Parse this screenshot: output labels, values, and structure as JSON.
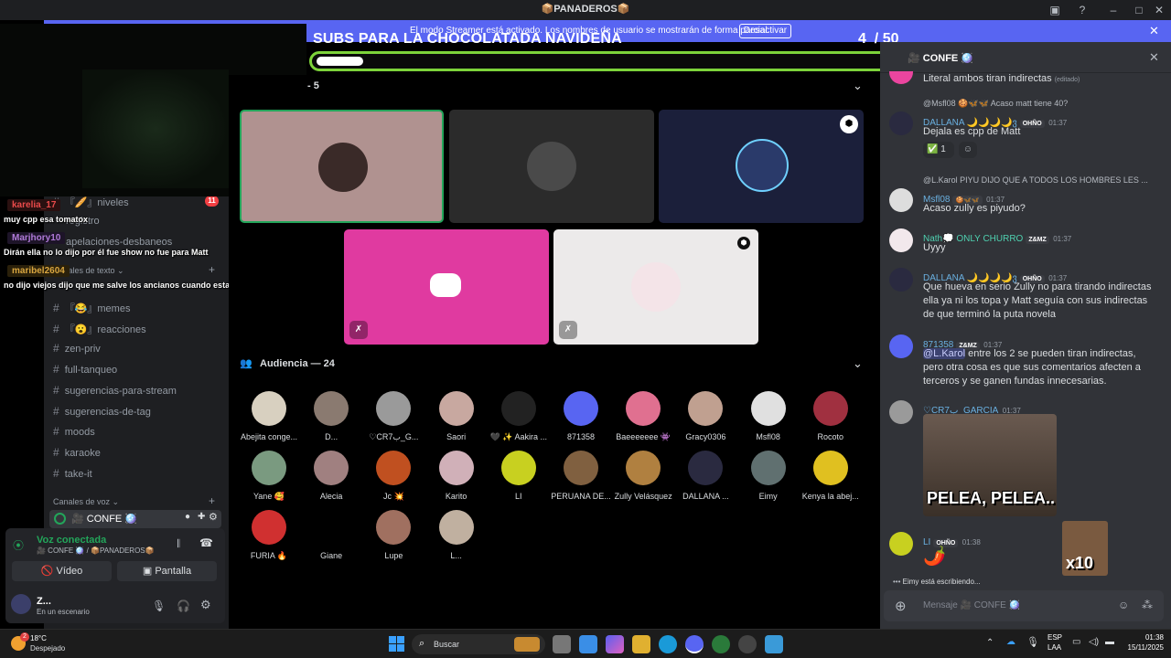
{
  "window": {
    "title": "📦PANADEROS📦"
  },
  "banner": {
    "text": "El modo Streamer está activado. Los nombres de usuario se mostrarán de forma parcial.",
    "button": "Desactivar"
  },
  "overlay": {
    "goal_title": "SUBS PARA LA CHOCOLATADA NAVIDEÑA",
    "goal_current": "4",
    "goal_sep": "/",
    "goal_total": "50",
    "goal_progress": 0.08
  },
  "sidebar": {
    "channels_top": [
      {
        "label": "『🥖』niveles",
        "badge": "11"
      },
      {
        "label": "registro"
      },
      {
        "label": "apelaciones-desbaneos"
      }
    ],
    "text_category": "Canales de texto",
    "channels": [
      {
        "label": "『😂』memes"
      },
      {
        "label": "『😮』reacciones"
      },
      {
        "label": "zen-priv"
      },
      {
        "label": "full-tanqueo"
      },
      {
        "label": "sugerencias-para-stream"
      },
      {
        "label": "sugerencias-de-tag"
      },
      {
        "label": "moods"
      },
      {
        "label": "karaoke"
      },
      {
        "label": "take-it"
      }
    ],
    "voice_category": "Canales de voz",
    "voice_channel": "🎥 CONFE 🪩"
  },
  "stream_chat": [
    {
      "user": "karelia_17",
      "color": "#e94a4a",
      "text": "muy cpp esa tomatox"
    },
    {
      "user": "Marjhory10",
      "color": "#b07ad8",
      "text": "Dirán ella no lo dijo por él fue show no fue para Matt"
    },
    {
      "user": "maribel2604",
      "color": "#d9a640",
      "text": "no dijo viejos dijo que me salve los ancianos cuando estaba con su sudoko"
    }
  ],
  "voice_panel": {
    "status": "Voz conectada",
    "location": "🎥 CONFE 🪩 / 📦PANADEROS📦",
    "video_label": "Vídeo",
    "screen_label": "Pantalla",
    "user_name": "Z...",
    "user_status": "En un escenario"
  },
  "stage": {
    "speakers_count": "5",
    "audience_label": "Audiencia — 24"
  },
  "audience": [
    {
      "name": "Abejita conge...",
      "color": "#d8d0c0"
    },
    {
      "name": "D...",
      "color": "#8a7a70"
    },
    {
      "name": "♡CR7ب_G...",
      "color": "#9a9a9a"
    },
    {
      "name": "Saori",
      "color": "#c8a8a0"
    },
    {
      "name": "🖤 ✨ Aakira ...",
      "color": "#222222"
    },
    {
      "name": "871358",
      "color": "#5865f2"
    },
    {
      "name": "Baeeeeeee 👾",
      "color": "#e07090"
    },
    {
      "name": "Gracy0306",
      "color": "#c0a090"
    },
    {
      "name": "Msfl08",
      "color": "#e0e0e0"
    },
    {
      "name": "Rocoto",
      "color": "#a03040"
    },
    {
      "name": "Yane 🥰",
      "color": "#7a9a80"
    },
    {
      "name": "Alecia",
      "color": "#a08080"
    },
    {
      "name": "Jc 💥",
      "color": "#c05020"
    },
    {
      "name": "Karito",
      "color": "#d0b0b8"
    },
    {
      "name": "LI",
      "color": "#c8d020"
    },
    {
      "name": "PERUANA DE...",
      "color": "#806040"
    },
    {
      "name": "Zully Velásquez",
      "color": "#b08040"
    },
    {
      "name": "DALLANA ...",
      "color": "#2a2a40"
    },
    {
      "name": "Eimy",
      "color": "#607070"
    },
    {
      "name": "Kenya la abej...",
      "color": "#e0c020"
    },
    {
      "name": "FURIA 🔥",
      "color": "#d03030"
    },
    {
      "name": "Giane",
      "color": "#000000"
    },
    {
      "name": "Lupe",
      "color": "#a07060"
    },
    {
      "name": "L...",
      "color": "#c0b0a0"
    }
  ],
  "chat": {
    "channel": "🎥 CONFE 🪩",
    "composer_placeholder": "Mensaje 🎥 CONFE 🪩",
    "typing": "Eimy está escribiendo...",
    "messages": [
      {
        "text": "Literal ambos tiran indirectas",
        "edited": "(editado)"
      },
      {
        "reply": "@Msfl08 🍪🦋🦋 Acaso matt tiene 40?",
        "user": "DALLANA 🌙🌙🌙🌙ვ",
        "tag": "OHÑO",
        "time": "01:37",
        "text": "Dejala es cpp de Matt",
        "reaction": "1",
        "user_color": "#6ab0e0"
      },
      {
        "reply": "@L.Karol PIYU DIJO QUE A TODOS LOS HOMBRES LES ...",
        "user": "Msfl08",
        "tag": "🍪🦋🦋",
        "time": "01:37",
        "text": "Acaso zully es piyudo?",
        "user_color": "#6ab0e0"
      },
      {
        "user": "Nath💭 ONLY CHURRO",
        "tag": "Z&MZ",
        "time": "01:37",
        "text": "Uyyy",
        "user_color": "#4fd1b0"
      },
      {
        "user": "DALLANA 🌙🌙🌙🌙ვ",
        "tag": "OHÑO",
        "time": "01:37",
        "text": "Que hueva en serio Zully no para tirando indirectas ella ya ni los topa y Matt seguía con sus indirectas de que terminó la puta novela",
        "user_color": "#6ab0e0"
      },
      {
        "user": "871358",
        "tag": "Z&MZ",
        "time": "01:37",
        "mention": "@L.Karol",
        "text": " entre los 2 se pueden tiran indirectas, pero otra cosa es que sus comentarios afecten a terceros y se ganen fundas innecesarias.",
        "user_color": "#6ab0e0"
      },
      {
        "user": "♡CR7ب_GARCIA",
        "time": "01:37",
        "gif_text": "PELEA, PELEA..",
        "user_color": "#6ab0e0"
      },
      {
        "user": "LI",
        "tag": "OHÑO",
        "time": "01:38",
        "text": "🌶️",
        "sticker_text": "x10",
        "user_color": "#6ab0e0"
      }
    ]
  },
  "taskbar": {
    "weather_temp": "18°C",
    "weather_desc": "Despejado",
    "weather_badge": "2",
    "search_placeholder": "Buscar",
    "lang": "ESP",
    "lang2": "LAA",
    "time": "01:38",
    "date": "15/11/2025"
  },
  "colors": {
    "blurple": "#5865f2",
    "goal_green": "#7dd33a",
    "discord_pink": "#eb459f"
  }
}
